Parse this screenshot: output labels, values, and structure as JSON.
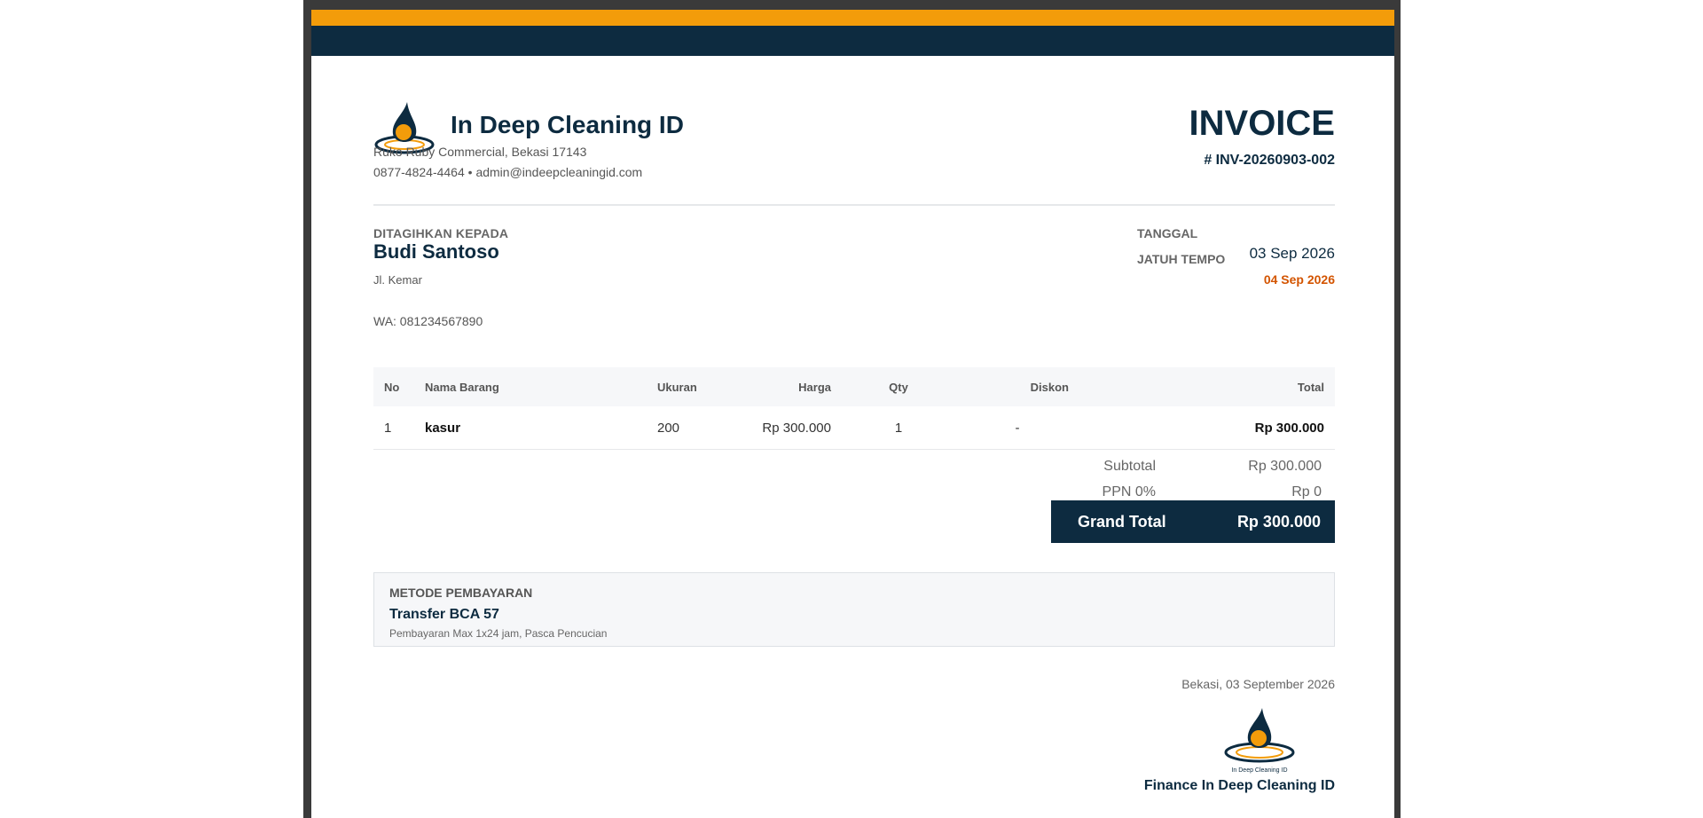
{
  "company": {
    "name": "In Deep Cleaning ID",
    "address": "Ruko Ruby Commercial, Bekasi 17143",
    "contact": "0877-4824-4464 • admin@indeepcleaningid.com",
    "logo_icon": "water-drop-logo-icon"
  },
  "invoice": {
    "title": "INVOICE",
    "number": "# INV-20260903-002"
  },
  "billing": {
    "label": "DITAGIHKAN KEPADA",
    "name": "Budi Santoso",
    "address": "Jl. Kemar",
    "wa": "WA: 081234567890"
  },
  "dates": {
    "date_label": "TANGGAL",
    "due_label": "JATUH TEMPO",
    "date_value": "03 Sep 2026",
    "due_value": "04 Sep 2026"
  },
  "table": {
    "headers": [
      "No",
      "Nama Barang",
      "Ukuran",
      "Harga",
      "Qty",
      "Diskon",
      "Total"
    ],
    "rows": [
      [
        "1",
        "kasur",
        "200",
        "Rp 300.000",
        "1",
        "-",
        "Rp 300.000"
      ]
    ]
  },
  "summary": {
    "subtotal_label": "Subtotal",
    "subtotal_value": "Rp 300.000",
    "ppn_label": "PPN 0%",
    "ppn_value": "Rp 0",
    "grand_label": "Grand Total",
    "grand_value": "Rp 300.000"
  },
  "payment": {
    "label": "METODE PEMBAYARAN",
    "method": "Transfer BCA 57",
    "note": "Pembayaran Max 1x24 jam, Pasca Pencucian"
  },
  "footer": {
    "place_date": "Bekasi, 03 September 2026",
    "signature_name": "Finance In Deep Cleaning ID",
    "signature_logo_text": "In Deep Cleaning ID"
  },
  "colors": {
    "gold": "#f39c0a",
    "navy": "#0d2b40",
    "due_orange": "#d35400"
  }
}
